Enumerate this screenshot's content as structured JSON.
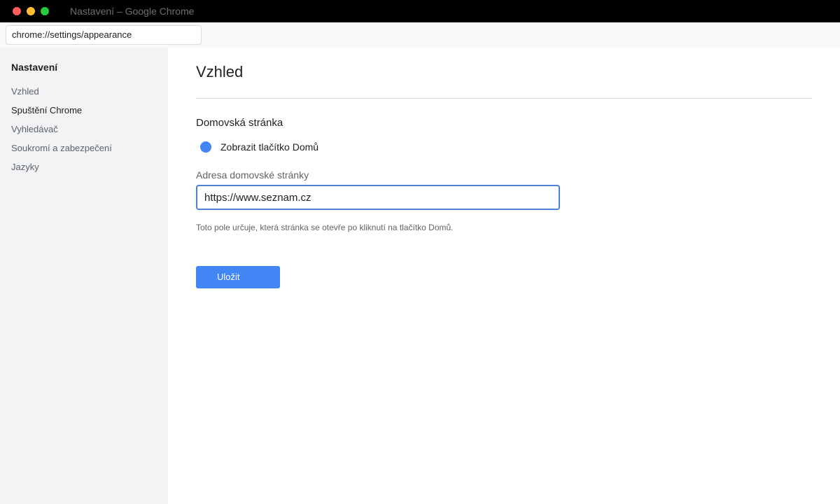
{
  "window": {
    "title": "Nastavení – Google Chrome",
    "controls": [
      "close",
      "minimize",
      "zoom"
    ]
  },
  "address_bar": {
    "url": "chrome://settings/appearance"
  },
  "sidebar": {
    "title": "Nastavení",
    "items": [
      {
        "label": "Vzhled"
      },
      {
        "label": "Spuštění Chrome",
        "active": true
      },
      {
        "label": "Vyhledávač"
      },
      {
        "label": "Soukromí a zabezpečení"
      },
      {
        "label": "Jazyky"
      }
    ]
  },
  "main": {
    "page_title": "Vzhled",
    "section_title": "Domovská stránka",
    "home_button_toggle": {
      "label": "Zobrazit tlačítko Domů",
      "checked": true
    },
    "homepage_field": {
      "label": "Adresa domovské stránky",
      "value": "https://www.seznam.cz"
    },
    "helper_text": "Toto pole určuje, která stránka se otevře po kliknutí na tlačítko Domů.",
    "save_label": "Uložit"
  },
  "colors": {
    "accent": "#4285f4",
    "titlebar": "#000000",
    "sidebar_bg": "#f1f3f4"
  }
}
